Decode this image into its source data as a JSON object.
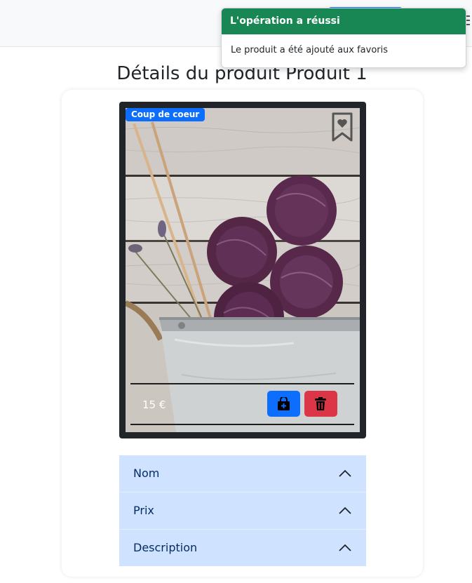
{
  "toast": {
    "title": "L'opération a réussi",
    "message": "Le produit a été ajouté aux favoris"
  },
  "page": {
    "title": "Détails du produit Produit 1"
  },
  "product": {
    "badge": "Coup de coeur",
    "price": "15 €",
    "image_alt": "Pelotes de laine violettes dans un seau avec des aiguilles à tricoter"
  },
  "accordion": {
    "items": [
      {
        "label": "Nom"
      },
      {
        "label": "Prix"
      },
      {
        "label": "Description"
      }
    ]
  },
  "colors": {
    "success": "#198754",
    "primary": "#0d6efd",
    "danger": "#dc3545",
    "accordion_bg": "#cfe2ff"
  }
}
